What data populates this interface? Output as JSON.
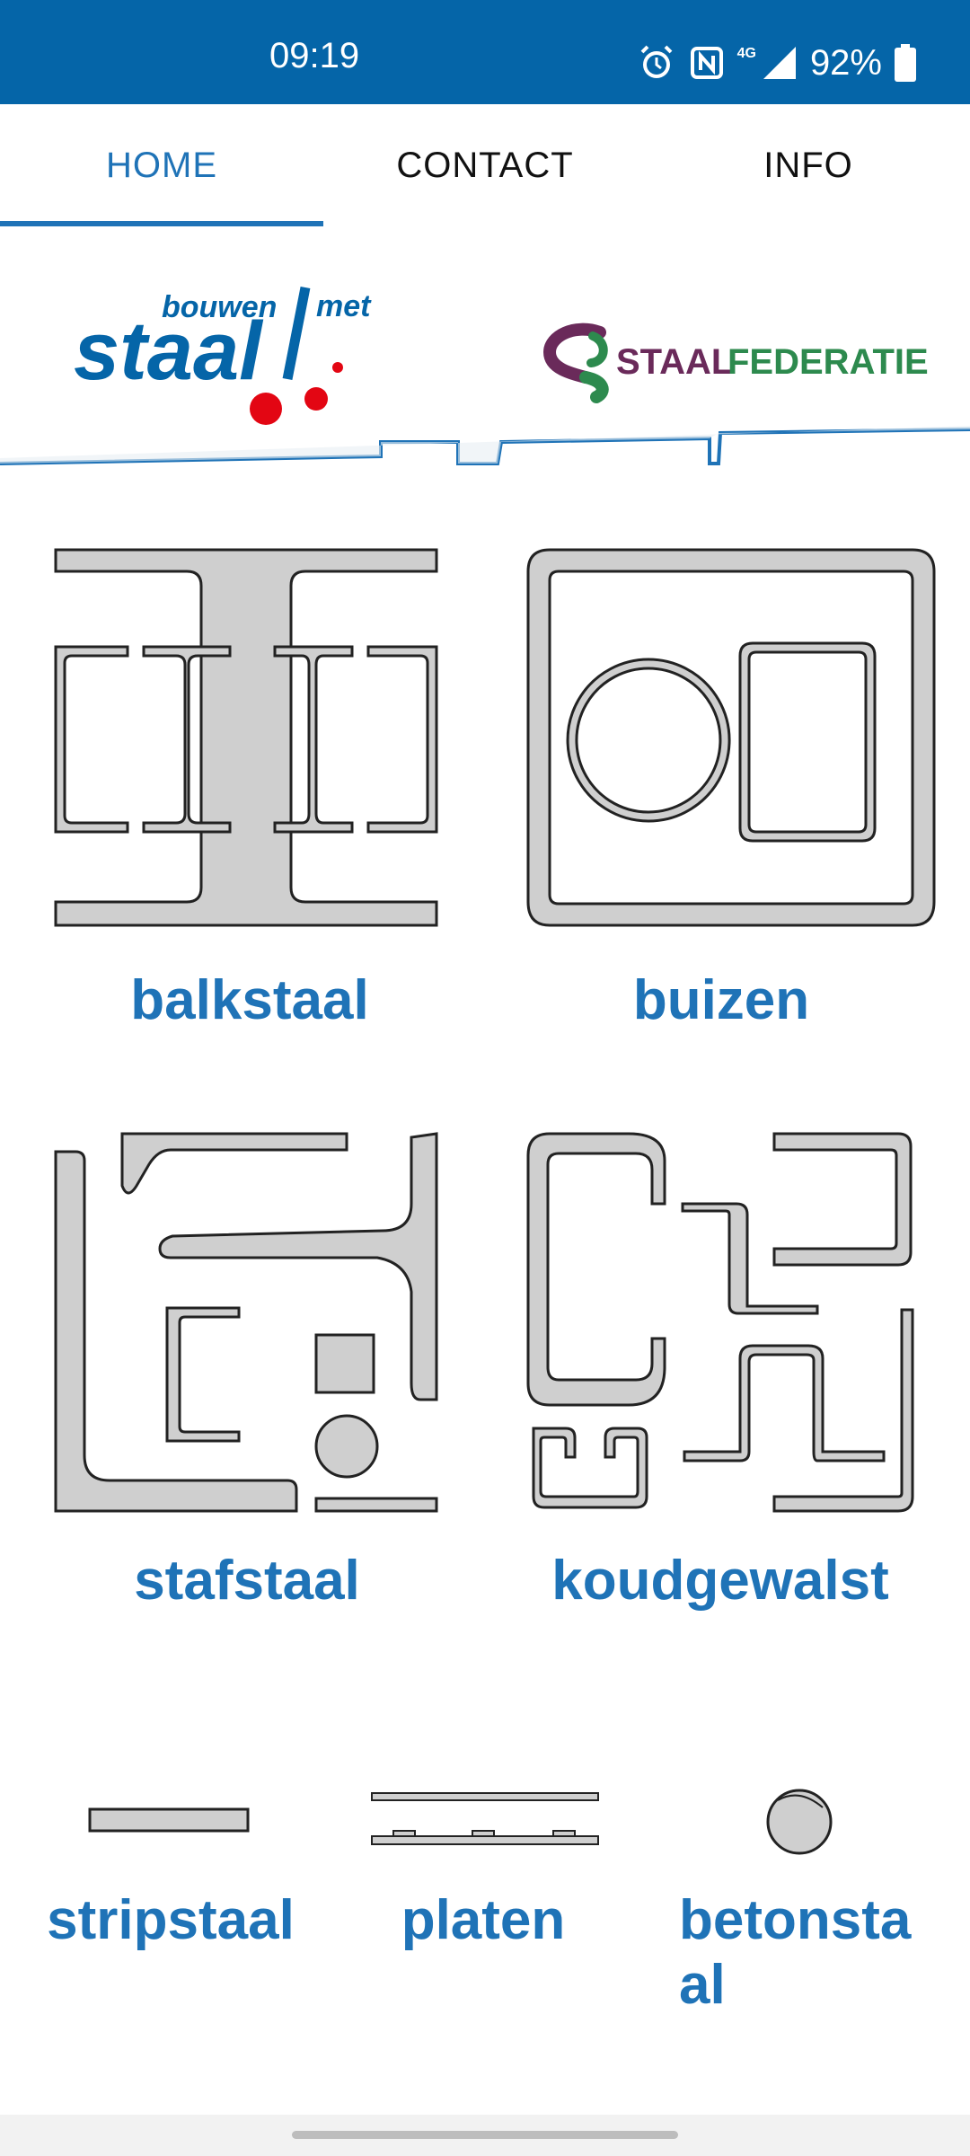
{
  "status": {
    "time": "09:19",
    "battery": "92%",
    "network": "4G",
    "icons": [
      "alarm-icon",
      "nfc-icon",
      "signal-icon",
      "battery-icon"
    ]
  },
  "tabs": [
    {
      "label": "HOME",
      "active": true
    },
    {
      "label": "CONTACT",
      "active": false
    },
    {
      "label": "INFO",
      "active": false
    }
  ],
  "logos": {
    "left": {
      "line1": "bouwen",
      "line1b": "met",
      "line2": "staal"
    },
    "right": {
      "part1": "STAAL",
      "part2": "FEDERATIE"
    }
  },
  "colors": {
    "brand_blue": "#1f73b7",
    "status_blue": "#0565a8",
    "steel_fill": "#cfcfcf",
    "red_dot": "#e30613",
    "federatie_purple": "#6a2a5a",
    "federatie_green": "#2d8a4e"
  },
  "categories": [
    {
      "label": "balkstaal"
    },
    {
      "label": "buizen"
    },
    {
      "label": "stafstaal"
    },
    {
      "label": "koudgewalst"
    },
    {
      "label": "stripstaal"
    },
    {
      "label": "platen"
    },
    {
      "label_line1": "betonsta",
      "label_line2": "al"
    }
  ]
}
